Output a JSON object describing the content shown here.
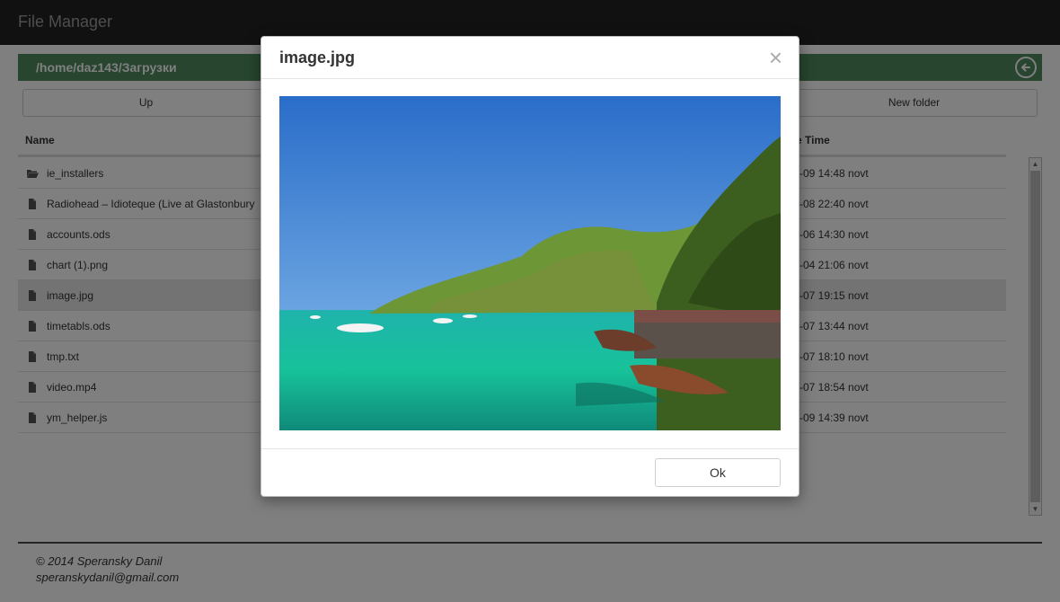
{
  "app": {
    "title": "File Manager"
  },
  "path": {
    "current": "/home/daz143/Загрузки"
  },
  "toolbar": {
    "up_label": "Up",
    "new_folder_label": "New folder"
  },
  "table": {
    "columns": {
      "name": "Name",
      "date_time": "e Time"
    },
    "rows": [
      {
        "name": "ie_installers",
        "date": "-09 14:48 novt",
        "type": "folder"
      },
      {
        "name": "Radiohead – Idioteque (Live at Glastonbury",
        "date": "-08 22:40 novt",
        "type": "file"
      },
      {
        "name": "accounts.ods",
        "date": "-06 14:30 novt",
        "type": "file"
      },
      {
        "name": "chart (1).png",
        "date": "-04 21:06 novt",
        "type": "file"
      },
      {
        "name": "image.jpg",
        "date": "-07 19:15 novt",
        "type": "file",
        "selected": true
      },
      {
        "name": "timetabls.ods",
        "date": "-07 13:44 novt",
        "type": "file"
      },
      {
        "name": "tmp.txt",
        "date": "-07 18:10 novt",
        "type": "file"
      },
      {
        "name": "video.mp4",
        "date": "-07 18:54 novt",
        "type": "file"
      },
      {
        "name": "ym_helper.js",
        "date": "-09 14:39 novt",
        "type": "file"
      }
    ]
  },
  "footer": {
    "copyright": "© 2014 Speransky Danil",
    "email": "speranskydanil@gmail.com"
  },
  "modal": {
    "title": "image.jpg",
    "close_symbol": "×",
    "ok_label": "Ok"
  },
  "colors": {
    "navbar": "#222222",
    "path_bar": "#4e8a5e",
    "selected_row": "#e6e6e6"
  },
  "icons": {
    "folder": "folder-open-icon",
    "file": "file-icon",
    "back": "arrow-left-circle-icon",
    "close": "close-icon"
  }
}
